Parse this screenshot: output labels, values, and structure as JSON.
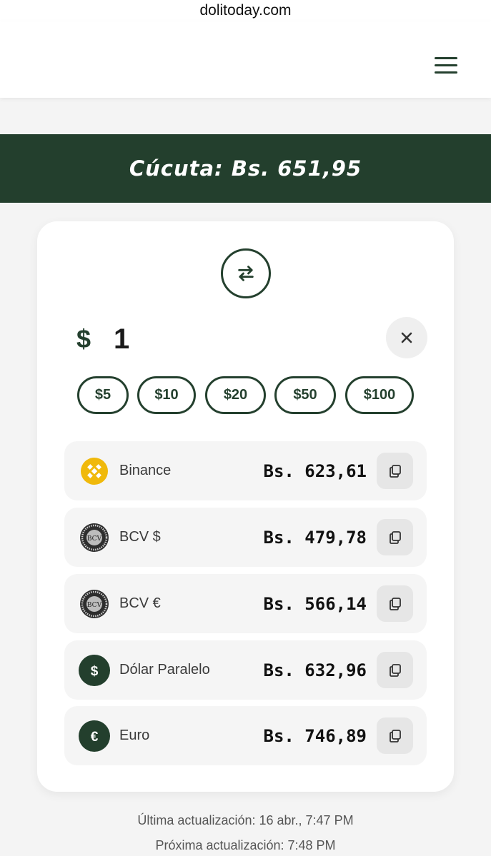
{
  "browser": {
    "url": "dolitoday.com"
  },
  "banner": {
    "text": "Cúcuta: Bs. 651,95"
  },
  "converter": {
    "currency_symbol": "$",
    "amount": "1",
    "quick_amounts": [
      "$5",
      "$10",
      "$20",
      "$50",
      "$100"
    ]
  },
  "rates": [
    {
      "name": "Binance",
      "value": "Bs. 623,61",
      "icon": "binance-icon"
    },
    {
      "name": "BCV $",
      "value": "Bs. 479,78",
      "icon": "bcv-seal-icon"
    },
    {
      "name": "BCV €",
      "value": "Bs. 566,14",
      "icon": "bcv-seal-icon"
    },
    {
      "name": "Dólar Paralelo",
      "value": "Bs. 632,96",
      "icon": "dollar-icon"
    },
    {
      "name": "Euro",
      "value": "Bs. 746,89",
      "icon": "euro-icon"
    }
  ],
  "footer": {
    "last_update": "Última actualización: 16 abr., 7:47 PM",
    "next_update": "Próxima actualización: 7:48 PM"
  },
  "icon_glyphs": {
    "dollar": "$",
    "euro": "€",
    "bcv_seal": "BCV"
  },
  "colors": {
    "brand_green": "#233f2d",
    "binance_yellow": "#f0b90b"
  }
}
